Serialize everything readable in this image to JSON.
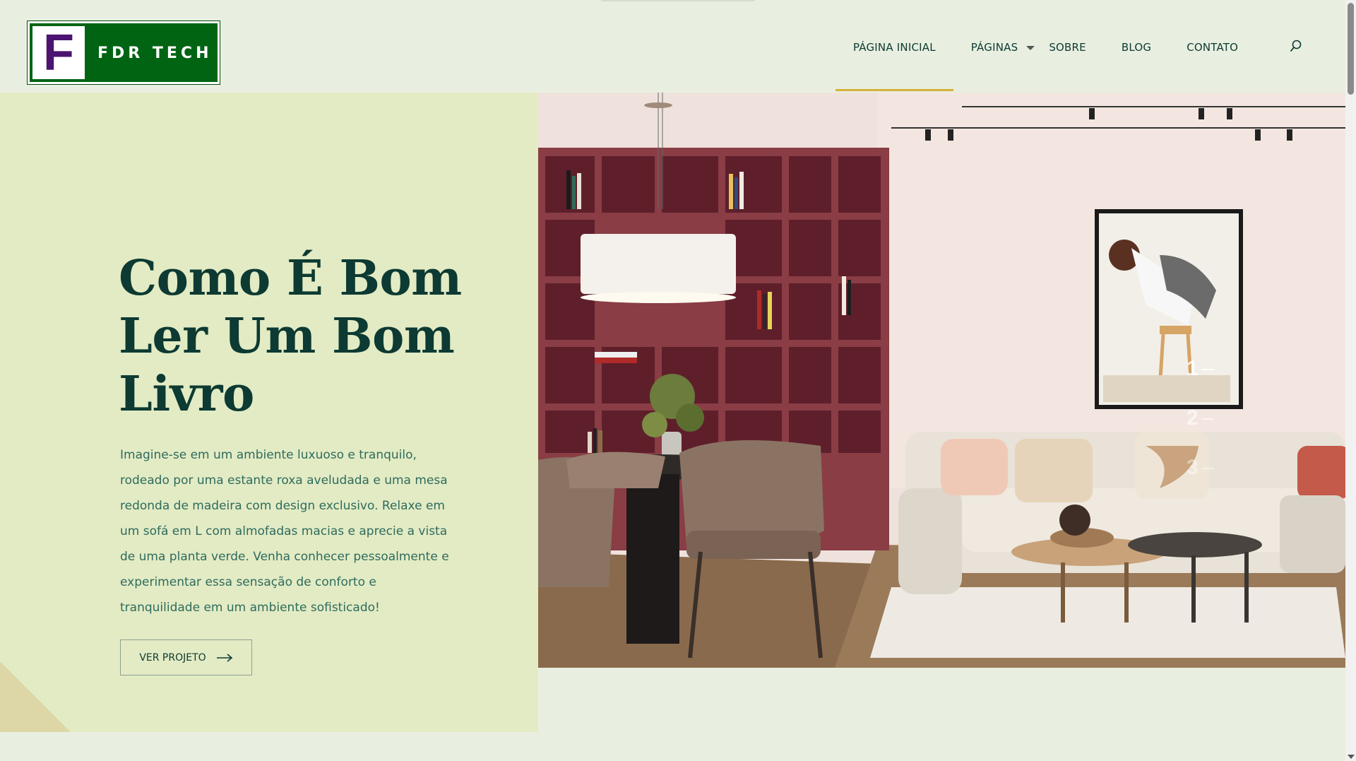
{
  "brand": {
    "logo_letter": "F",
    "logo_text": "FDR TECH",
    "logo_bg": "#006413",
    "logo_letter_color": "#4a1470"
  },
  "nav": {
    "items": [
      {
        "label": "PÁGINA INICIAL",
        "active": true
      },
      {
        "label": "PÁGINAS",
        "has_dropdown": true
      },
      {
        "label": "SOBRE"
      },
      {
        "label": "BLOG"
      },
      {
        "label": "CONTATO"
      }
    ],
    "search_icon": "search-icon",
    "active_color": "#d6b13b"
  },
  "hero": {
    "title": "Como É Bom Ler Um Bom Livro",
    "description": "Imagine-se em um ambiente luxuoso e tranquilo, rodeado por uma estante roxa aveludada e uma mesa redonda de madeira com design exclusivo. Relaxe em um sofá em L com almofadas macias e aprecie a vista de uma planta verde. Venha conhecer pessoalmente e experimentar essa sensação de conforto e tranquilidade em um ambiente sofisticado!",
    "cta_label": "VER PROJETO",
    "cta_icon": "arrow-right-icon",
    "slides": [
      "1",
      "2",
      "3"
    ],
    "active_slide": 1
  },
  "colors": {
    "page_bg": "#e9efe0",
    "panel_bg": "#e2ebc4",
    "title": "#0d3a32",
    "text": "#2f6b5d"
  }
}
